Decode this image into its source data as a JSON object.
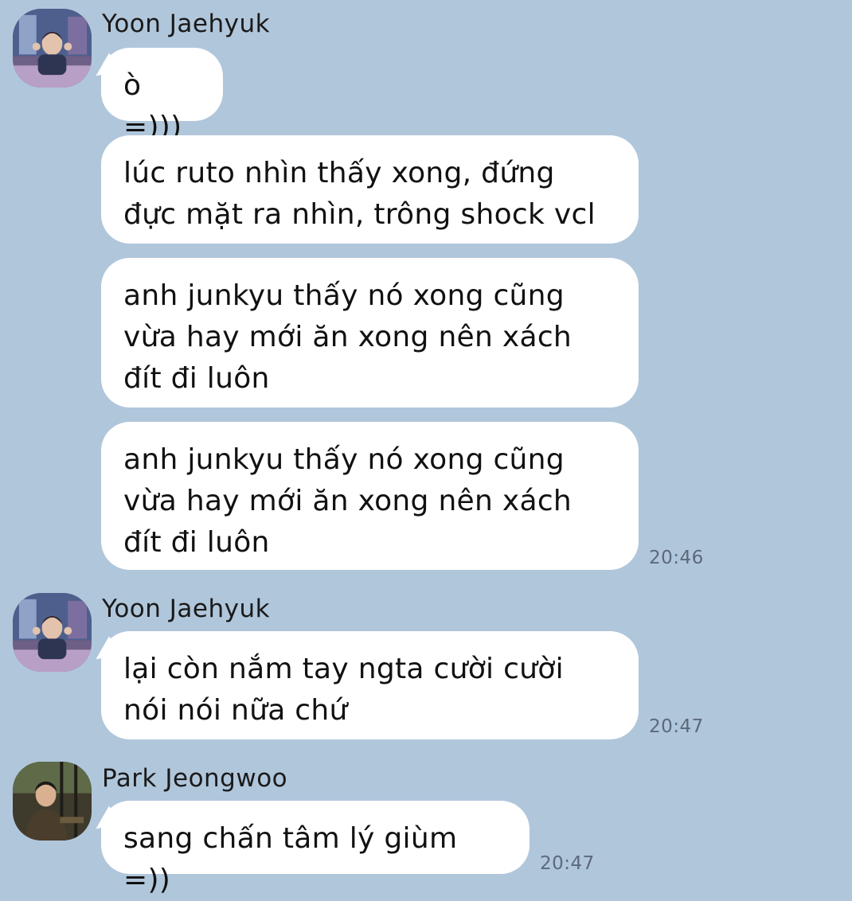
{
  "messages": [
    {
      "sender": "Yoon Jaehyuk",
      "avatar": "avatar-yoon-jaehyuk",
      "bubbles": [
        "ò =)))",
        "lúc ruto nhìn thấy xong, đứng đực mặt ra nhìn, trông shock vcl",
        "anh junkyu thấy nó xong cũng vừa hay mới ăn xong nên xách đít đi luôn",
        "anh junkyu thấy nó xong cũng vừa hay mới ăn xong nên xách đít đi luôn"
      ],
      "time": "20:46"
    },
    {
      "sender": "Yoon Jaehyuk",
      "avatar": "avatar-yoon-jaehyuk",
      "bubbles": [
        "lại còn nắm tay ngta cười cười nói nói nữa chứ"
      ],
      "time": "20:47"
    },
    {
      "sender": "Park Jeongwoo",
      "avatar": "avatar-park-jeongwoo",
      "bubbles": [
        "sang chấn tâm lý giùm =))"
      ],
      "time": "20:47"
    }
  ],
  "colors": {
    "background": "#b0c6db",
    "bubble": "#ffffff",
    "timestamp": "#5b6a7a"
  }
}
